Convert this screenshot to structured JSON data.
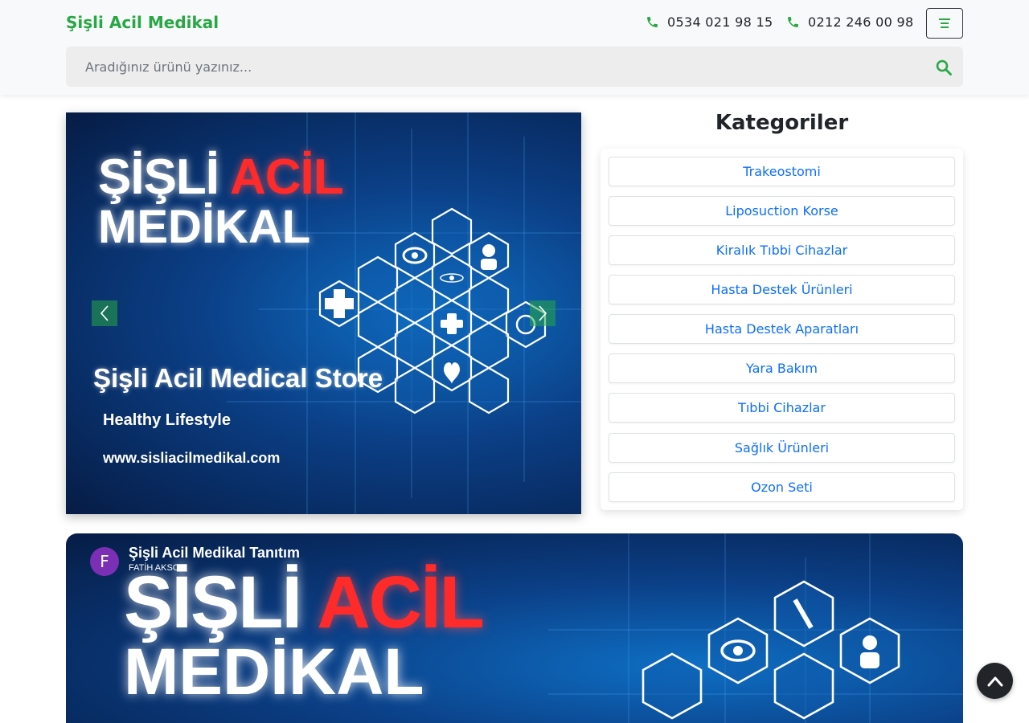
{
  "header": {
    "brand": "Şişli Acil Medikal",
    "phones": [
      "0534 021 98 15",
      "0212 246 00 98"
    ],
    "menu_icon": "bars-icon",
    "phone_icon": "phone-icon"
  },
  "search": {
    "placeholder": "Aradığınız ürünü yazınız...",
    "value": "",
    "icon": "search-icon"
  },
  "carousel": {
    "logo_word_1": "ŞİŞLİ",
    "logo_word_2": "ACİL",
    "logo_word_3": "MEDİKAL",
    "title": "Şişli Acil Medical Store",
    "subtitle": "Healthy Lifestyle",
    "url": "www.sisliacilmedikal.com",
    "prev_icon": "chevron-left-icon",
    "next_icon": "chevron-right-icon"
  },
  "categories": {
    "title": "Kategoriler",
    "items": [
      {
        "label": "Trakeostomi"
      },
      {
        "label": "Liposuction Korse"
      },
      {
        "label": "Kiralık Tıbbi Cihazlar"
      },
      {
        "label": "Hasta Destek Ürünleri"
      },
      {
        "label": "Hasta Destek Aparatları"
      },
      {
        "label": "Yara Bakım"
      },
      {
        "label": "Tıbbi Cihazlar"
      },
      {
        "label": "Sağlık Ürünleri"
      },
      {
        "label": "Ozon Seti"
      }
    ]
  },
  "video": {
    "avatar_letter": "F",
    "title": "Şişli Acil Medikal Tanıtım",
    "channel": "FATİH AKSOY",
    "logo_word_1": "ŞİŞLİ",
    "logo_word_2": "ACİL",
    "logo_word_3": "MEDİKAL"
  },
  "colors": {
    "brand_green": "#28a745",
    "link_blue": "#0d6efd",
    "banner_blue": "#0b3f86",
    "logo_red": "#ff2a2a"
  },
  "scroll_top_icon": "chevron-up-icon"
}
